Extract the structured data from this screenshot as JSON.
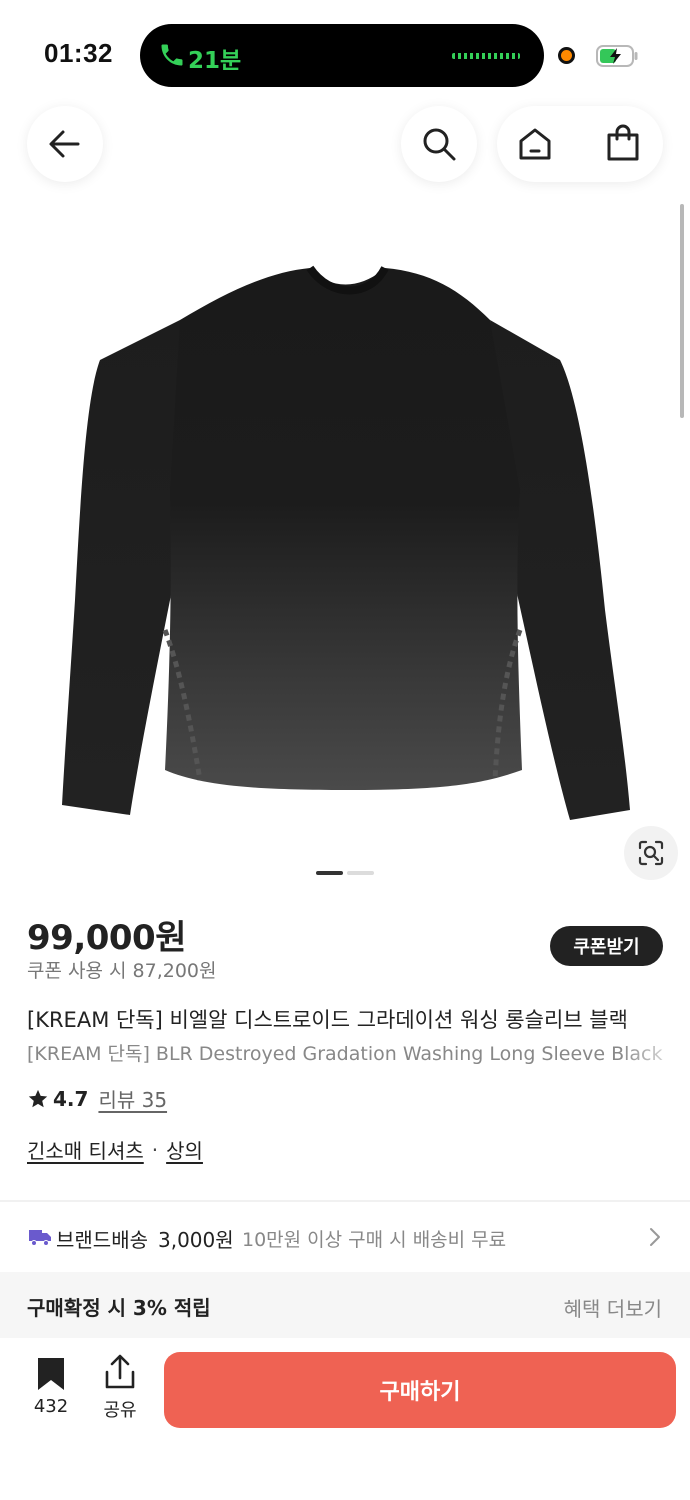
{
  "status_bar": {
    "time": "01:32",
    "call_duration": "21분",
    "icons": [
      "phone-call-icon",
      "waveform-icon",
      "orange-dot-indicator",
      "battery-charging-icon"
    ]
  },
  "nav": {
    "icons": [
      "arrow-left-icon",
      "search-icon",
      "home-icon",
      "shopping-bag-icon"
    ]
  },
  "gallery": {
    "image_alt": "black long sleeve t-shirt",
    "page_indicator": {
      "total": 2,
      "current": 1
    },
    "lens_icon": "image-search-icon"
  },
  "product": {
    "price": "99,000원",
    "coupon_price": "쿠폰 사용 시 87,200원",
    "coupon_button": "쿠폰받기",
    "title_ko": "[KREAM 단독] 비엘알 디스트로이드 그라데이션 워싱 롱슬리브 블랙",
    "title_en": "[KREAM 단독] BLR Destroyed Gradation Washing Long Sleeve Black",
    "rating": "4.7",
    "review_label": "리뷰 35",
    "category_main": "긴소매 티셔츠",
    "category_separator": "·",
    "category_sub": "상의"
  },
  "shipping": {
    "label": "브랜드배송",
    "fee": "3,000원",
    "note": "10만원 이상 구매 시 배송비 무료"
  },
  "benefit": {
    "text": "구매확정 시 3% 적립",
    "more": "혜택 더보기"
  },
  "bottom_bar": {
    "bookmark_count": "432",
    "share_label": "공유",
    "buy_label": "구매하기"
  },
  "colors": {
    "buy_button": "#ef6253",
    "coupon_button": "#222222",
    "call_green": "#34d058",
    "shipping_truck": "#6a5acd"
  }
}
